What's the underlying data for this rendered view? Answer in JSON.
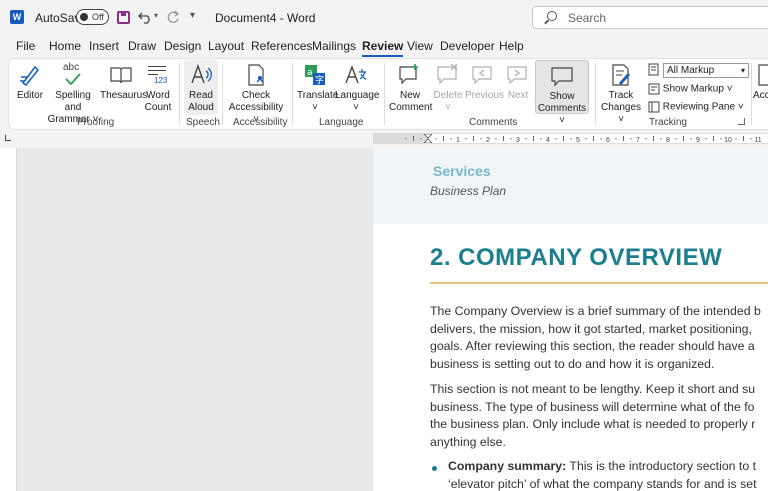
{
  "titlebar": {
    "autosave_label": "AutoSave",
    "autosave_state": "Off",
    "document_title": "Document4  -  Word",
    "search_placeholder": "Search"
  },
  "menu": {
    "tabs": [
      "File",
      "Home",
      "Insert",
      "Draw",
      "Design",
      "Layout",
      "References",
      "Mailings",
      "Review",
      "View",
      "Developer",
      "Help"
    ],
    "active": "Review"
  },
  "ribbon": {
    "proofing": {
      "label": "Proofing",
      "editor": "Editor",
      "spelling": [
        "Spelling and",
        "Grammar ˅"
      ],
      "thesaurus": "Thesaurus",
      "word_count": [
        "Word",
        "Count"
      ],
      "spell_glyph": "abc",
      "count_glyph": "123"
    },
    "speech": {
      "label": "Speech",
      "read_aloud": [
        "Read",
        "Aloud"
      ]
    },
    "accessibility": {
      "label": "Accessibility",
      "check": [
        "Check",
        "Accessibility ˅"
      ]
    },
    "language": {
      "label": "Language",
      "translate": [
        "Translate",
        "˅"
      ],
      "language": [
        "Language",
        "˅"
      ]
    },
    "comments": {
      "label": "Comments",
      "new": [
        "New",
        "Comment"
      ],
      "delete": [
        "Delete",
        "˅"
      ],
      "previous": "Previous",
      "next": "Next",
      "show": [
        "Show",
        "Comments ˅"
      ]
    },
    "tracking": {
      "label": "Tracking",
      "track_changes": [
        "Track",
        "Changes ˅"
      ],
      "markup_value": "All Markup",
      "show_markup": "Show Markup ˅",
      "reviewing_pane": "Reviewing Pane  ˅"
    },
    "more": {
      "partial": "Acc"
    }
  },
  "ruler": {
    "numbers": [
      "1",
      "2",
      "3",
      "4",
      "5",
      "6",
      "7",
      "8",
      "9",
      "10",
      "11"
    ]
  },
  "document": {
    "header_title": "Services",
    "header_subtitle": "Business Plan",
    "heading": "2.   COMPANY OVERVIEW",
    "paragraph1": [
      "The Company Overview is a brief summary of the intended b",
      "delivers, the mission, how it got started, market positioning,",
      "goals. After reviewing this section, the reader should have a",
      "business is setting out to do and how it is organized."
    ],
    "paragraph2": [
      "This section is not meant to be lengthy. Keep it short and su",
      "business. The type of business will determine what of the fo",
      "the business plan. Only include what is needed to properly r",
      "anything else."
    ],
    "bullet1": {
      "term": "Company summary:",
      "lines": [
        " This is the introductory section to t",
        "‘elevator pitch’ of what the company stands for and is set"
      ]
    }
  },
  "colors": {
    "accent": "#185abd",
    "heading": "#1d7f8e",
    "header_title": "#79b7c8",
    "rule": "#f0c080"
  }
}
